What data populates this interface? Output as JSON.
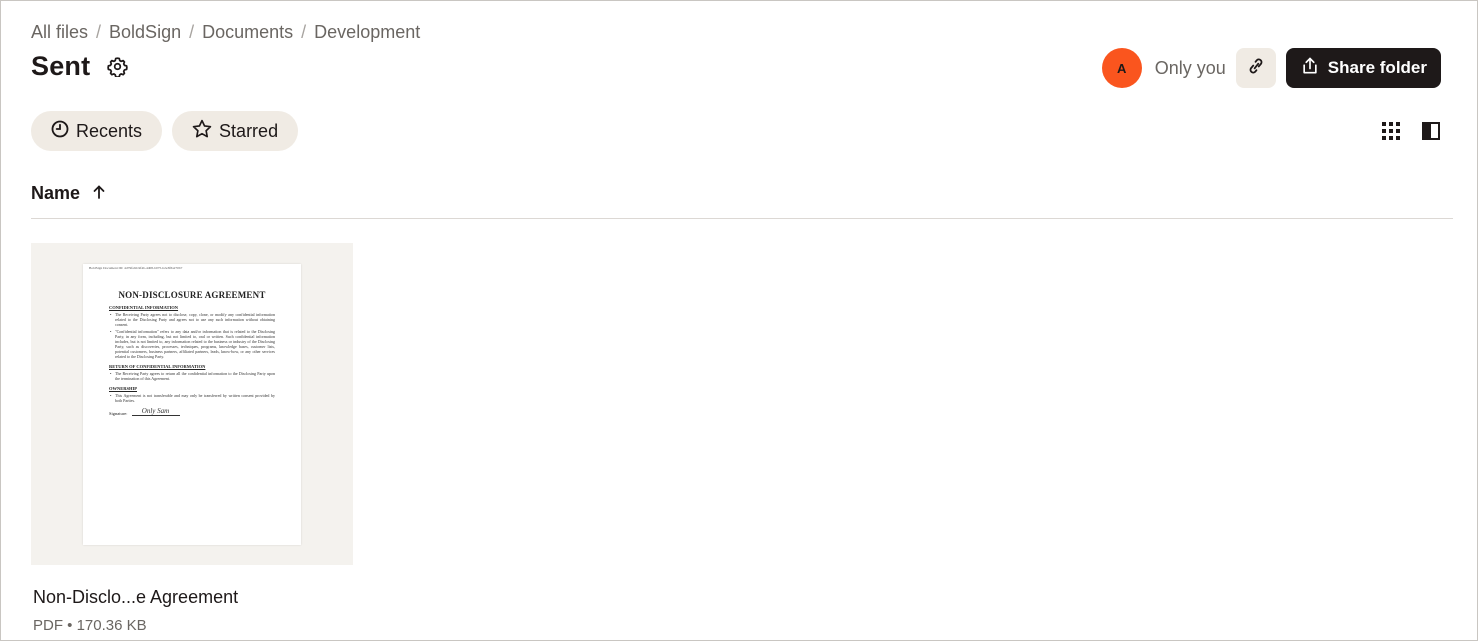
{
  "breadcrumb": {
    "items": [
      "All files",
      "BoldSign",
      "Documents",
      "Development"
    ],
    "separator": "/"
  },
  "page": {
    "title": "Sent"
  },
  "share": {
    "avatar_letter": "A",
    "avatar_color": "#fa551e",
    "visibility": "Only you",
    "share_button_label": "Share folder"
  },
  "filters": {
    "recents_label": "Recents",
    "starred_label": "Starred"
  },
  "list": {
    "sort_column": "Name",
    "sort_direction_icon": "arrow-up-icon"
  },
  "files": [
    {
      "name": "Non-Disclo...e Agreement",
      "meta": "PDF • 170.36 KB",
      "thumbnail": {
        "header": "BoldSign Document ID: 4d79fab0-9f4b-4d08-b075-b2e3f8a270b7",
        "title": "NON-DISCLOSURE AGREEMENT",
        "sections": [
          {
            "heading": "CONFIDENTIAL INFORMATION",
            "bullets": [
              "The Receiving Party agrees not to disclose, copy, clone, or modify any confidential information related to the Disclosing Party and agrees not to use any such information without obtaining consent.",
              "\"Confidential information\" refers to any data and/or information that is related to the Disclosing Party, in any form, including, but not limited to, oral or written. Such confidential information includes, but is not limited to, any information related to the business or industry of the Disclosing Party, such as discoveries, processes, techniques, programs, knowledge bases, customer lists, potential customers, business partners, affiliated partners, leads, know-how, or any other services related to the Disclosing Party."
            ]
          },
          {
            "heading": "RETURN OF CONFIDENTIAL INFORMATION",
            "bullets": [
              "The Receiving Party agrees to return all the confidential information to the Disclosing Party upon the termination of this Agreement."
            ]
          },
          {
            "heading": "OWNERSHIP",
            "bullets": [
              "This Agreement is not transferable and may only be transferred by written consent provided by both Parties."
            ]
          }
        ],
        "signature_label": "Signature:",
        "signature_text": "Only Sam"
      }
    }
  ],
  "colors": {
    "chip_bg": "#f0ebe4",
    "primary_button": "#1e1919",
    "text_primary": "#1e1919",
    "text_secondary": "#6a6662"
  }
}
